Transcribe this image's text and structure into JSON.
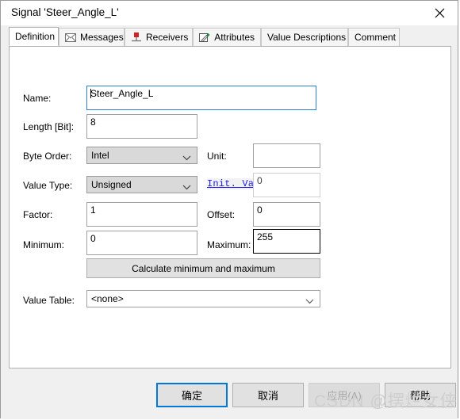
{
  "window": {
    "title": "Signal 'Steer_Angle_L'",
    "close_icon": "close-icon"
  },
  "tabs": [
    {
      "label": "Definition",
      "icon": "none",
      "active": true
    },
    {
      "label": "Messages",
      "icon": "envelope-icon",
      "active": false
    },
    {
      "label": "Receivers",
      "icon": "node-icon",
      "active": false
    },
    {
      "label": "Attributes",
      "icon": "pencil-icon",
      "active": false
    },
    {
      "label": "Value Descriptions",
      "icon": "none",
      "active": false
    },
    {
      "label": "Comment",
      "icon": "none",
      "active": false
    }
  ],
  "form": {
    "name_label": "Name:",
    "name_value": "Steer_Angle_L",
    "length_label": "Length [Bit]:",
    "length_value": "8",
    "byte_order_label": "Byte Order:",
    "byte_order_value": "Intel",
    "unit_label": "Unit:",
    "unit_value": "",
    "value_type_label": "Value Type:",
    "value_type_value": "Unsigned",
    "init_value_label": "Init. Value",
    "init_value_value": "0",
    "factor_label": "Factor:",
    "factor_value": "1",
    "offset_label": "Offset:",
    "offset_value": "0",
    "minimum_label": "Minimum:",
    "minimum_value": "0",
    "maximum_label": "Maximum:",
    "maximum_value": "255",
    "calculate_button": "Calculate minimum and maximum",
    "value_table_label": "Value Table:",
    "value_table_value": "<none>"
  },
  "footer": {
    "ok": "确定",
    "cancel": "取消",
    "apply": "应用(A)",
    "help": "帮助"
  },
  "watermark": "CSDN @摆烂女侠",
  "colors": {
    "accent": "#0078d7",
    "link": "#1a1af0",
    "focus_border": "#2a7fd4",
    "field_border": "#a0a0a0",
    "panel_bg": "#ffffff",
    "dialog_bg": "#f0f0f0"
  }
}
